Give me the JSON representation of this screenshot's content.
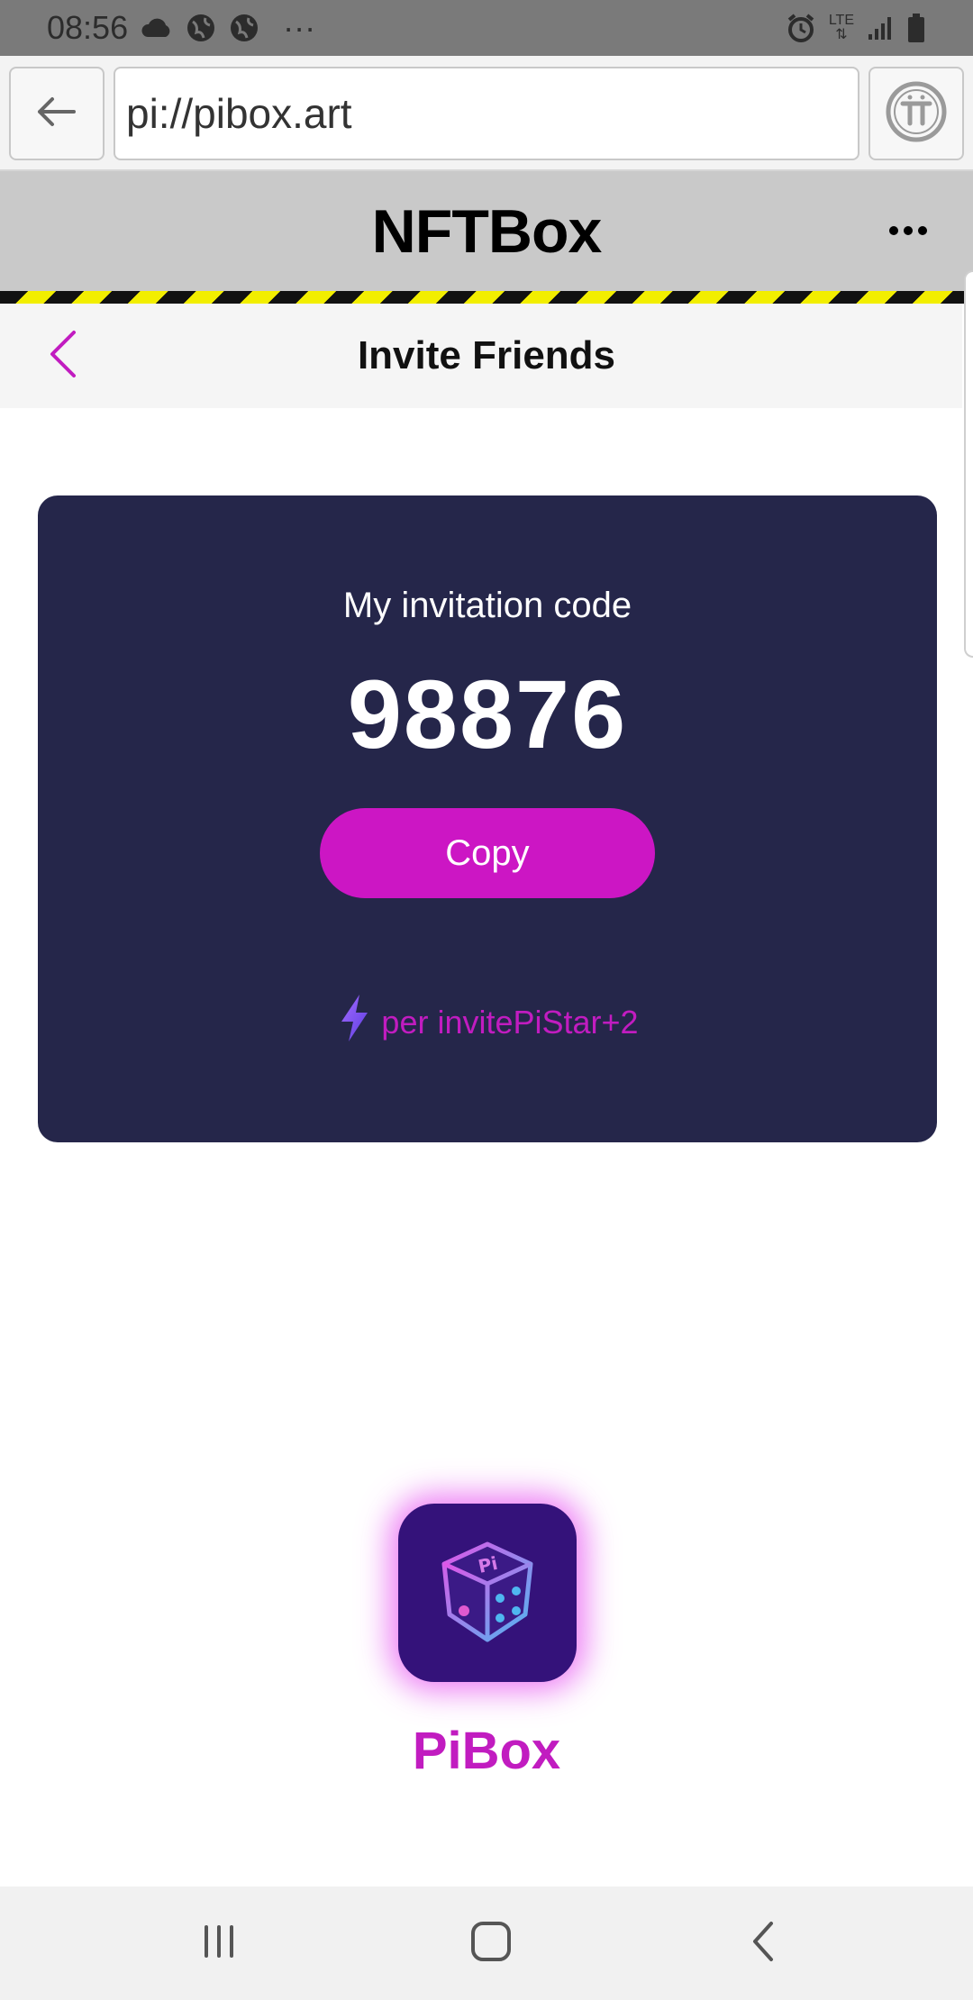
{
  "status_bar": {
    "time": "08:56",
    "more_indicator": "···",
    "network_label": "LTE"
  },
  "browser": {
    "url": "pi://pibox.art",
    "back_icon": "arrow-left-icon",
    "pi_icon": "pi-logo-icon"
  },
  "app": {
    "title": "NFTBox",
    "more_icon": "more-horizontal-icon"
  },
  "page": {
    "title": "Invite Friends",
    "back_icon": "chevron-left-icon"
  },
  "invite": {
    "label": "My invitation code",
    "code": "98876",
    "copy_label": "Copy",
    "reward_text": "per invitePiStar+2",
    "reward_icon": "lightning-icon"
  },
  "brand": {
    "name": "PiBox",
    "logo_icon": "dice-logo-icon"
  },
  "colors": {
    "accent": "#cc16c4",
    "card_bg": "#25264a",
    "header_bg": "#c9c9c9"
  }
}
